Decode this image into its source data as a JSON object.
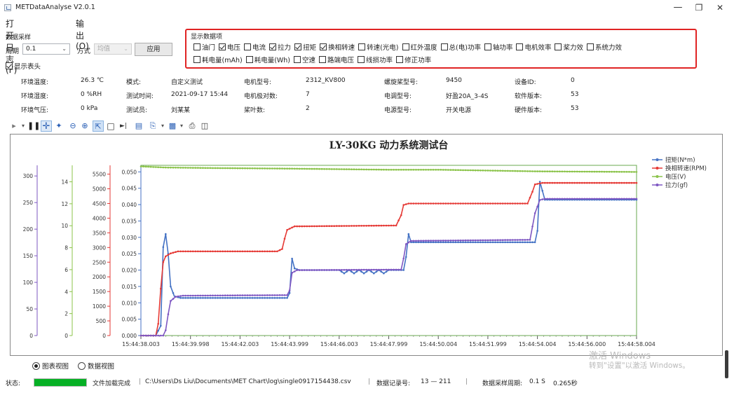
{
  "window": {
    "title": "METDataAnalyse V2.0.1",
    "minimize": "—",
    "maximize": "❐",
    "close": "✕"
  },
  "menu": [
    "打开日志(F)",
    "输出(O)"
  ],
  "sampling": {
    "group_label": "数据采样",
    "period_label": "周期",
    "period_value": "0.1",
    "method_label": "方式",
    "method_value": "均值",
    "apply_label": "应用",
    "show_header_label": "显示表头",
    "show_header_checked": true
  },
  "display_items": {
    "group_label": "显示数据项",
    "row1": [
      {
        "label": "油门",
        "checked": false
      },
      {
        "label": "电压",
        "checked": true
      },
      {
        "label": "电流",
        "checked": false
      },
      {
        "label": "拉力",
        "checked": true
      },
      {
        "label": "扭矩",
        "checked": true
      },
      {
        "label": "换相转速",
        "checked": true
      },
      {
        "label": "转速(光电)",
        "checked": false
      },
      {
        "label": "红外温度",
        "checked": false
      },
      {
        "label": "总(电)功率",
        "checked": false
      },
      {
        "label": "轴功率",
        "checked": false
      },
      {
        "label": "电机效率",
        "checked": false
      },
      {
        "label": "桨力效",
        "checked": false
      },
      {
        "label": "系统力效",
        "checked": false
      }
    ],
    "row2": [
      {
        "label": "耗电量(mAh)",
        "checked": false
      },
      {
        "label": "耗电量(Wh)",
        "checked": false
      },
      {
        "label": "空速",
        "checked": false
      },
      {
        "label": "路端电压",
        "checked": false
      },
      {
        "label": "线损功率",
        "checked": false
      },
      {
        "label": "修正功率",
        "checked": false
      }
    ]
  },
  "info": {
    "env_temp_label": "环境温度:",
    "env_temp_value": "26.3 ℃",
    "env_humidity_label": "环境湿度:",
    "env_humidity_value": "0 %RH",
    "env_pressure_label": "环境气压:",
    "env_pressure_value": "0 kPa",
    "mode_label": "模式:",
    "mode_value": "自定义测试",
    "test_time_label": "测试时间:",
    "test_time_value": "2021-09-17 15:44",
    "tester_label": "测试员:",
    "tester_value": "刘某某",
    "motor_model_label": "电机型号:",
    "motor_model_value": "2312_KV800",
    "motor_poles_label": "电机极对数:",
    "motor_poles_value": "7",
    "blade_count_label": "桨叶数:",
    "blade_count_value": "2",
    "prop_model_label": "螺旋桨型号:",
    "prop_model_value": "9450",
    "esc_model_label": "电调型号:",
    "esc_model_value": "好盈20A_3-4S",
    "power_model_label": "电源型号:",
    "power_model_value": "开关电源",
    "device_id_label": "设备ID:",
    "device_id_value": "0",
    "software_label": "软件版本:",
    "software_value": "53",
    "hardware_label": "硬件版本:",
    "hardware_value": "53"
  },
  "toolbar_icons": [
    "play-icon",
    "dropdown-icon",
    "pause-icon",
    "pan-icon",
    "select-zoom-icon",
    "zoom-out-icon",
    "zoom-in-icon",
    "pointer-icon",
    "box-zoom-icon",
    "reset-axis-icon",
    "properties-icon",
    "copy-icon",
    "save-icon",
    "print-icon",
    "print-preview-icon"
  ],
  "view_mode": {
    "chart_label": "图表视图",
    "data_label": "数据视图",
    "selected": "chart"
  },
  "status": {
    "label": "状态:",
    "progress_percent": 100,
    "message": "文件加载完成",
    "file_path": "C:\\Users\\Ds Liu\\Documents\\MET Chart\\log\\single0917154438.csv",
    "record_label": "数据记录号:",
    "record_range": "13 — 211",
    "period_label": "数据采样周期:",
    "period_value": "0.1 S",
    "elapsed": "0.265秒"
  },
  "watermark": {
    "line1": "激活 Windows",
    "line2": "转到\"设置\"以激活 Windows。"
  },
  "colors": {
    "torque": "#4472c4",
    "rpm": "#e53935",
    "voltage": "#8bc34a",
    "thrust": "#7e57c2",
    "highlight_border": "#e02424",
    "progress": "#06b025"
  },
  "chart_data": {
    "type": "line",
    "title": "LY-30KG 动力系统测试台",
    "x_ticks": [
      "15:44:38.003",
      "15:44:39.998",
      "15:44:42.003",
      "15:44:43.999",
      "15:44:46.003",
      "15:44:47.999",
      "15:44:50.004",
      "15:44:51.999",
      "15:44:54.004",
      "15:44:56.000",
      "15:44:58.004"
    ],
    "x_range_seconds": [
      0,
      20.0
    ],
    "axes": [
      {
        "id": "thrust",
        "ticks": [
          "0",
          "50",
          "100",
          "150",
          "200",
          "250",
          "300"
        ],
        "range": [
          0,
          320
        ]
      },
      {
        "id": "voltage",
        "ticks": [
          "0",
          "2",
          "4",
          "6",
          "8",
          "10",
          "12",
          "14"
        ],
        "range": [
          0,
          15.5
        ]
      },
      {
        "id": "rpm",
        "ticks": [
          "0",
          "500",
          "1000",
          "1500",
          "2000",
          "2500",
          "3000",
          "3500",
          "4000",
          "4500",
          "5000",
          "5500"
        ],
        "range": [
          0,
          5800
        ]
      },
      {
        "id": "torque",
        "ticks": [
          "0.000",
          "0.005",
          "0.010",
          "0.015",
          "0.020",
          "0.025",
          "0.030",
          "0.035",
          "0.040",
          "0.045",
          "0.050"
        ],
        "range": [
          0,
          0.052
        ]
      }
    ],
    "series": [
      {
        "name": "扭矩(N*m)",
        "axis": "torque",
        "color": "#4472c4",
        "points": [
          [
            0,
            0
          ],
          [
            0.6,
            0
          ],
          [
            0.8,
            0.003
          ],
          [
            0.9,
            0.027
          ],
          [
            1.0,
            0.031
          ],
          [
            1.1,
            0.025
          ],
          [
            1.2,
            0.015
          ],
          [
            1.35,
            0.012
          ],
          [
            1.6,
            0.0115
          ],
          [
            5.9,
            0.0115
          ],
          [
            6.0,
            0.013
          ],
          [
            6.1,
            0.0235
          ],
          [
            6.2,
            0.0205
          ],
          [
            6.4,
            0.02
          ],
          [
            8.0,
            0.02
          ],
          [
            8.2,
            0.019
          ],
          [
            8.4,
            0.02
          ],
          [
            8.6,
            0.019
          ],
          [
            8.8,
            0.02
          ],
          [
            9.0,
            0.019
          ],
          [
            9.2,
            0.02
          ],
          [
            9.4,
            0.019
          ],
          [
            9.6,
            0.02
          ],
          [
            9.8,
            0.019
          ],
          [
            10.0,
            0.02
          ],
          [
            10.6,
            0.02
          ],
          [
            10.7,
            0.024
          ],
          [
            10.8,
            0.031
          ],
          [
            10.9,
            0.0285
          ],
          [
            11.0,
            0.0285
          ],
          [
            15.9,
            0.0285
          ],
          [
            16.0,
            0.032
          ],
          [
            16.1,
            0.047
          ],
          [
            16.3,
            0.0415
          ],
          [
            20.0,
            0.0415
          ]
        ]
      },
      {
        "name": "换相转速(RPM)",
        "axis": "rpm",
        "color": "#e53935",
        "points": [
          [
            0,
            0
          ],
          [
            0.6,
            0
          ],
          [
            0.7,
            400
          ],
          [
            0.8,
            1600
          ],
          [
            0.9,
            2500
          ],
          [
            1.0,
            2700
          ],
          [
            1.2,
            2800
          ],
          [
            1.5,
            2870
          ],
          [
            5.5,
            2870
          ],
          [
            5.7,
            2950
          ],
          [
            5.8,
            3300
          ],
          [
            5.9,
            3600
          ],
          [
            6.2,
            3720
          ],
          [
            10.3,
            3750
          ],
          [
            10.5,
            4100
          ],
          [
            10.6,
            4450
          ],
          [
            10.8,
            4500
          ],
          [
            15.6,
            4500
          ],
          [
            15.8,
            4900
          ],
          [
            15.9,
            5150
          ],
          [
            16.2,
            5200
          ],
          [
            20.0,
            5200
          ]
        ]
      },
      {
        "name": "电压(V)",
        "axis": "voltage",
        "color": "#8bc34a",
        "points": [
          [
            0,
            15.4
          ],
          [
            1.0,
            15.3
          ],
          [
            3.0,
            15.25
          ],
          [
            6.0,
            15.2
          ],
          [
            10.0,
            15.1
          ],
          [
            12.0,
            15.1
          ],
          [
            16.0,
            14.95
          ],
          [
            20.0,
            14.9
          ]
        ]
      },
      {
        "name": "拉力(gf)",
        "axis": "thrust",
        "color": "#7e57c2",
        "points": [
          [
            0,
            0
          ],
          [
            0.9,
            0
          ],
          [
            1.0,
            10
          ],
          [
            1.1,
            40
          ],
          [
            1.2,
            65
          ],
          [
            1.4,
            73
          ],
          [
            1.7,
            75
          ],
          [
            5.9,
            76
          ],
          [
            6.0,
            85
          ],
          [
            6.1,
            118
          ],
          [
            6.3,
            123
          ],
          [
            10.5,
            124
          ],
          [
            10.6,
            145
          ],
          [
            10.7,
            172
          ],
          [
            10.9,
            178
          ],
          [
            15.7,
            180
          ],
          [
            15.9,
            230
          ],
          [
            16.1,
            255
          ],
          [
            16.3,
            257
          ],
          [
            20.0,
            257
          ]
        ]
      }
    ]
  }
}
